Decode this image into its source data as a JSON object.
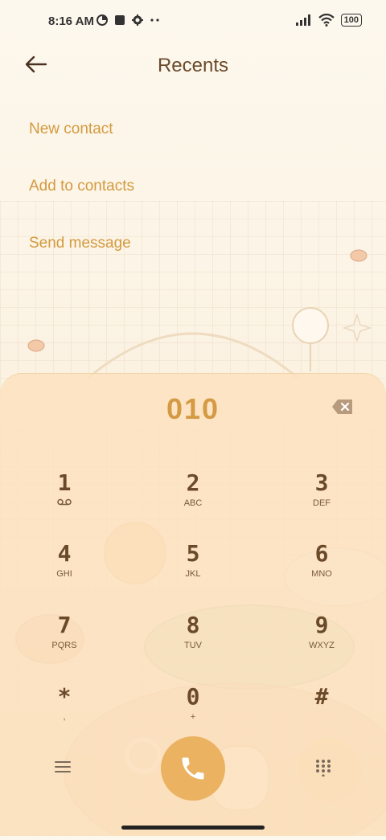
{
  "status_bar": {
    "time": "8:16 AM",
    "battery": "100",
    "icons": [
      "data-saver-icon",
      "square-icon",
      "gear-icon",
      "dots-icon",
      "signal-icon",
      "wifi-icon",
      "battery-icon"
    ]
  },
  "header": {
    "title": "Recents"
  },
  "menu": {
    "items": [
      {
        "label": "New contact"
      },
      {
        "label": "Add to contacts"
      },
      {
        "label": "Send message"
      }
    ]
  },
  "dialer": {
    "number": "010",
    "keys": [
      {
        "digit": "1",
        "letters": ""
      },
      {
        "digit": "2",
        "letters": "ABC"
      },
      {
        "digit": "3",
        "letters": "DEF"
      },
      {
        "digit": "4",
        "letters": "GHI"
      },
      {
        "digit": "5",
        "letters": "JKL"
      },
      {
        "digit": "6",
        "letters": "MNO"
      },
      {
        "digit": "7",
        "letters": "PQRS"
      },
      {
        "digit": "8",
        "letters": "TUV"
      },
      {
        "digit": "9",
        "letters": "WXYZ"
      },
      {
        "digit": "*",
        "letters": ","
      },
      {
        "digit": "0",
        "letters": "+"
      },
      {
        "digit": "#",
        "letters": ""
      }
    ]
  },
  "colors": {
    "accent": "#d39a3f",
    "call_button": "#ebb262",
    "text": "#6b4a2a"
  }
}
